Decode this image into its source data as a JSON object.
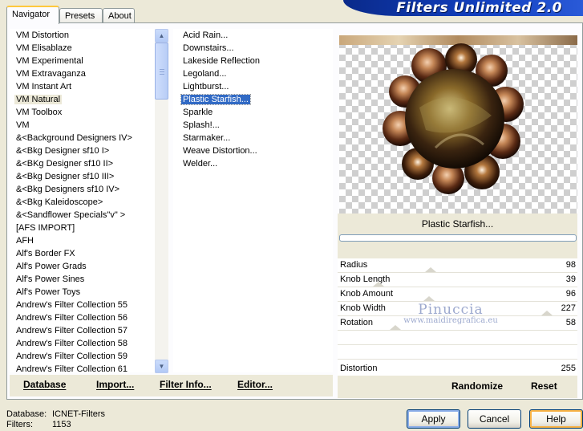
{
  "header": {
    "title": "Filters Unlimited 2.0"
  },
  "tabs": [
    {
      "label": "Navigator",
      "active": true
    },
    {
      "label": "Presets",
      "active": false
    },
    {
      "label": "About",
      "active": false
    }
  ],
  "categories": {
    "items": [
      "VM Distortion",
      "VM Elisablaze",
      "VM Experimental",
      "VM Extravaganza",
      "VM Instant Art",
      "VM Natural",
      "VM Toolbox",
      "VM",
      "&<Background Designers IV>",
      "&<Bkg Designer sf10 I>",
      "&<BKg Designer sf10 II>",
      "&<Bkg Designer sf10 III>",
      "&<Bkg Designers sf10 IV>",
      "&<Bkg Kaleidoscope>",
      "&<Sandflower Specials\"v\" >",
      "[AFS IMPORT]",
      "AFH",
      "Alf's Border FX",
      "Alf's Power Grads",
      "Alf's Power Sines",
      "Alf's Power Toys",
      "Andrew's Filter Collection 55",
      "Andrew's Filter Collection 56",
      "Andrew's Filter Collection 57",
      "Andrew's Filter Collection 58",
      "Andrew's Filter Collection 59",
      "Andrew's Filter Collection 61"
    ],
    "selected_index": 5
  },
  "filters": {
    "items": [
      "Acid Rain...",
      "Downstairs...",
      "Lakeside Reflection",
      "Legoland...",
      "Lightburst...",
      "Plastic Starfish...",
      "Sparkle",
      "Splash!...",
      "Starmaker...",
      "Weave Distortion...",
      "Welder..."
    ],
    "selected_index": 5
  },
  "left_buttons": {
    "database": "Database",
    "import": "Import...",
    "filter_info": "Filter Info...",
    "editor": "Editor..."
  },
  "preview": {
    "filter_name": "Plastic Starfish..."
  },
  "parameters": [
    {
      "name": "Radius",
      "value": "98",
      "level": 0.384
    },
    {
      "name": "Knob Length",
      "value": "39",
      "level": 0.153
    },
    {
      "name": "Knob Amount",
      "value": "96",
      "level": 0.376
    },
    {
      "name": "Knob Width",
      "value": "227",
      "level": 0.89
    },
    {
      "name": "Rotation",
      "value": "58",
      "level": 0.227
    }
  ],
  "distortion": {
    "name": "Distortion",
    "value": "255"
  },
  "right_buttons": {
    "randomize": "Randomize",
    "reset": "Reset"
  },
  "watermark": {
    "line1": "Pinuccia",
    "line2": "www.maidiregrafica.eu"
  },
  "footer": {
    "database_label": "Database:",
    "database_value": "ICNET-Filters",
    "filters_label": "Filters:",
    "filters_value": "1153"
  },
  "dialog_buttons": {
    "apply": "Apply",
    "cancel": "Cancel",
    "help": "Help"
  },
  "colors": {
    "banner": "#1240c0",
    "selection": "#316ac5",
    "face": "#ece9d8"
  }
}
